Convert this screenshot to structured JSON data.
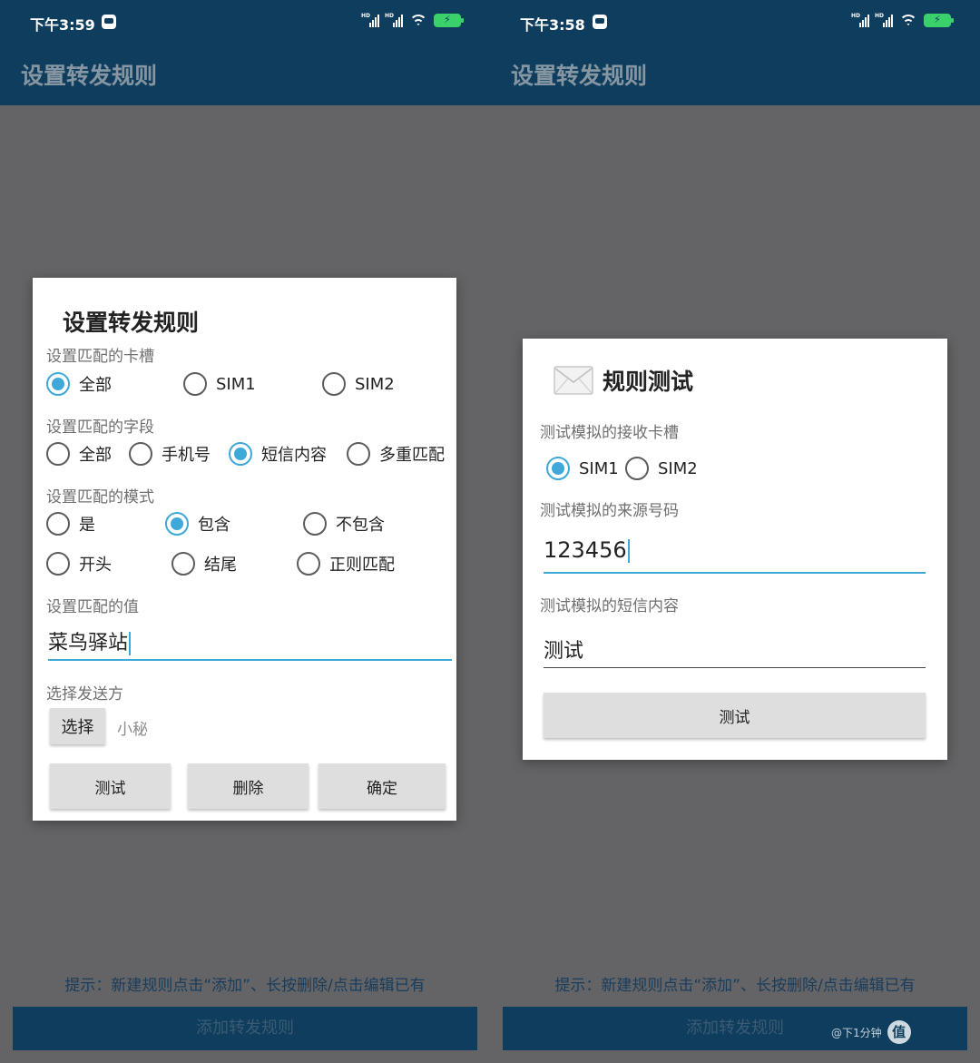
{
  "left": {
    "status": {
      "time": "下午3:59"
    },
    "appbar_title": "设置转发规则",
    "dialog": {
      "title": "设置转发规则",
      "slot_label": "设置匹配的卡槽",
      "slot_options": [
        "全部",
        "SIM1",
        "SIM2"
      ],
      "slot_selected": "全部",
      "field_label": "设置匹配的字段",
      "field_options": [
        "全部",
        "手机号",
        "短信内容",
        "多重匹配"
      ],
      "field_selected": "短信内容",
      "mode_label": "设置匹配的模式",
      "mode_options": [
        "是",
        "包含",
        "不包含",
        "开头",
        "结尾",
        "正则匹配"
      ],
      "mode_selected": "包含",
      "value_label": "设置匹配的值",
      "value": "菜鸟驿站",
      "sender_label": "选择发送方",
      "select_button": "选择",
      "sender_value": "小秘",
      "test_button": "测试",
      "delete_button": "删除",
      "confirm_button": "确定"
    },
    "hint": "提示：新建规则点击“添加”、长按删除/点击编辑已有",
    "add_button": "添加转发规则"
  },
  "right": {
    "status": {
      "time": "下午3:58"
    },
    "appbar_title": "设置转发规则",
    "dialog": {
      "title": "规则测试",
      "icon": "envelope-icon",
      "slot_label": "测试模拟的接收卡槽",
      "slot_options": [
        "SIM1",
        "SIM2"
      ],
      "slot_selected": "SIM1",
      "number_label": "测试模拟的来源号码",
      "number_value": "123456",
      "content_label": "测试模拟的短信内容",
      "content_value": "测试",
      "test_button": "测试"
    },
    "hint": "提示：新建规则点击“添加”、长按删除/点击编辑已有",
    "add_button": "添加转发规则",
    "watermark_badge": "值",
    "watermark_text": "@下1分钟"
  },
  "colors": {
    "appbar": "#0e3d5e",
    "overlay": "#646466",
    "accent": "#3ea8d8",
    "battery": "#3ad06a"
  }
}
